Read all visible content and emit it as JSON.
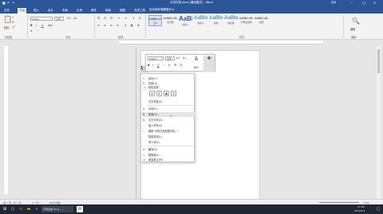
{
  "titlebar": {
    "title": "示例文档.docx [兼容模式] - Word",
    "user": "登录"
  },
  "tabs": {
    "file": "文件",
    "home": "开始",
    "insert": "插入",
    "design": "设计",
    "layout": "布局",
    "references": "引用",
    "mailings": "邮件",
    "review": "审阅",
    "view": "视图",
    "dev": "开发工具",
    "tellme": "告诉我你想要做什么"
  },
  "ribbon": {
    "paste": "粘贴",
    "font_name": "Calibri",
    "font_size": "五号",
    "groups": {
      "clipboard": "剪贴板",
      "font": "字体",
      "paragraph": "段落",
      "styles": "样式",
      "editing": "编辑"
    },
    "styles": [
      {
        "sample": "AaBbCcDd",
        "name": "正文"
      },
      {
        "sample": "AaBbCcDd",
        "name": "无间隔"
      },
      {
        "sample": "AaBl",
        "name": "标题 1"
      },
      {
        "sample": "AaBb(",
        "name": "标题 2"
      },
      {
        "sample": "AaBb(",
        "name": "标题"
      },
      {
        "sample": "AaBb(",
        "name": "副标题"
      },
      {
        "sample": "AaBbCcDd",
        "name": "不明显强调"
      },
      {
        "sample": "AaBbCcDd",
        "name": "强调"
      }
    ],
    "editing": "编辑"
  },
  "doc": {
    "selected_text": "1"
  },
  "mini_toolbar": {
    "font_name": "Calibri",
    "font_size": "五号",
    "styles_label": "样式",
    "new_comment": "新建批注"
  },
  "context_menu": {
    "items": [
      "剪切(T)",
      "复制(C)",
      "粘贴选项:",
      "汉字重选(V)",
      "字体(F)...",
      "段落(P)...",
      "文字方向(X)...",
      "插入符号(S)",
      "智能查找(L)",
      "同义词(Y)",
      "翻译(S)",
      "超链接(I)...",
      "新建批注(M)"
    ],
    "search_item": "搜索\"示例文档标题内容...\""
  },
  "status": {
    "page": "第 1 页，共 1 页",
    "words": "1 个字",
    "lang": "中文(中国)",
    "zoom": "100%"
  },
  "taskbar": {
    "task1": "示例文档.docx - ...",
    "time": "17:05",
    "date": "2019/1/1"
  }
}
